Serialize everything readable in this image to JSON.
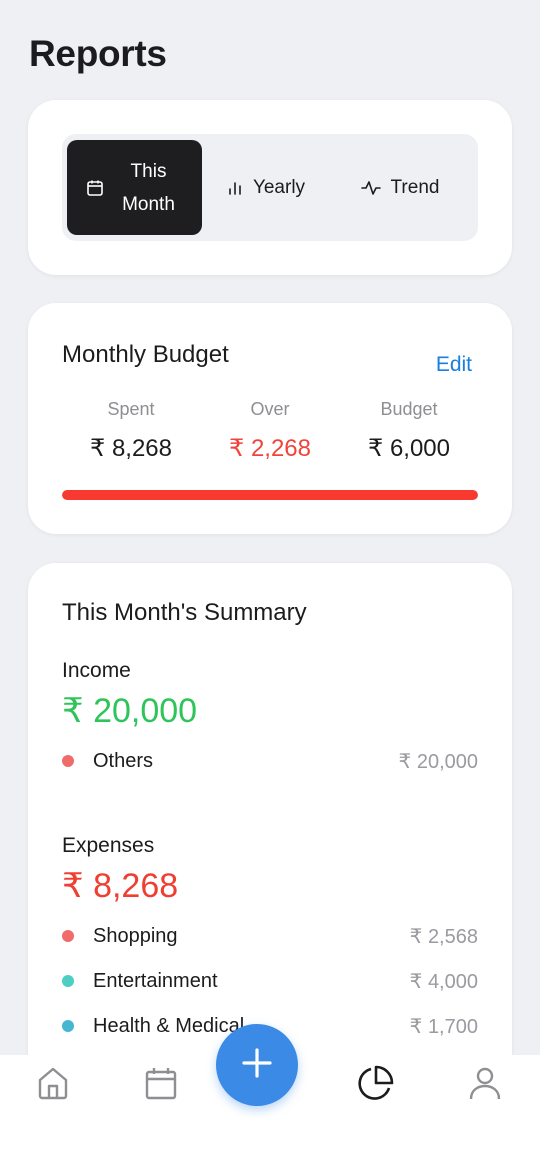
{
  "header": {
    "title": "Reports"
  },
  "tabs": [
    {
      "label": "This Month",
      "icon": "calendar-icon",
      "active": true
    },
    {
      "label": "Yearly",
      "icon": "bar-chart-icon",
      "active": false
    },
    {
      "label": "Trend",
      "icon": "pulse-icon",
      "active": false
    }
  ],
  "budget": {
    "title": "Monthly Budget",
    "edit_label": "Edit",
    "spent_label": "Spent",
    "spent_value": "₹ 8,268",
    "over_label": "Over",
    "over_value": "₹ 2,268",
    "budget_label": "Budget",
    "budget_value": "₹ 6,000",
    "progress_fraction": 1.0,
    "progress_color": "#f8392f"
  },
  "summary": {
    "title": "This Month's Summary",
    "income": {
      "label": "Income",
      "total": "₹ 20,000",
      "color": "#2fc45a",
      "items": [
        {
          "name": "Others",
          "amount": "₹ 20,000",
          "color": "#f06b6b"
        }
      ]
    },
    "expenses": {
      "label": "Expenses",
      "total": "₹ 8,268",
      "color": "#ef3f33",
      "items": [
        {
          "name": "Shopping",
          "amount": "₹ 2,568",
          "color": "#f06b6b"
        },
        {
          "name": "Entertainment",
          "amount": "₹ 4,000",
          "color": "#4ecdc4"
        },
        {
          "name": "Health & Medical",
          "amount": "₹ 1,700",
          "color": "#45b7d1"
        }
      ]
    }
  },
  "nav": {
    "items": [
      {
        "icon": "home-icon",
        "active": false
      },
      {
        "icon": "calendar-icon",
        "active": false
      },
      {
        "icon": "plus-icon",
        "active": false
      },
      {
        "icon": "pie-chart-icon",
        "active": true
      },
      {
        "icon": "user-icon",
        "active": false
      }
    ],
    "accent": "#3a8ae6"
  }
}
